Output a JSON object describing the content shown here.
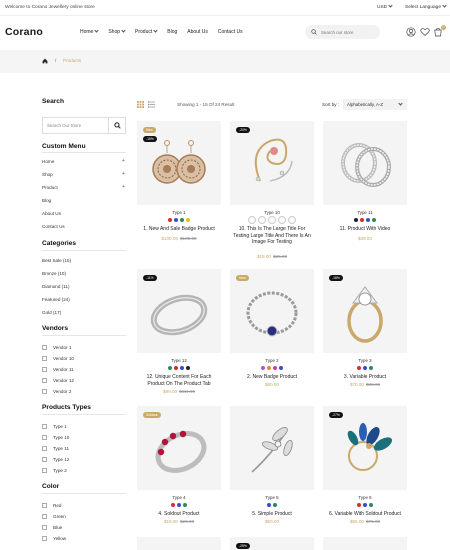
{
  "topbar": {
    "welcome": "Welcome to Corano Jewellery online store",
    "currency": "USD",
    "language": "Select Language"
  },
  "header": {
    "logo": "Corano",
    "nav": [
      "Home",
      "Shop",
      "Product",
      "Blog",
      "About Us",
      "Contact Us"
    ],
    "search_placeholder": "Search our store",
    "cart_count": "0"
  },
  "breadcrumb": {
    "separator": "/",
    "current": "Products"
  },
  "sidebar": {
    "search_title": "Search",
    "search_placeholder": "Search Our Store",
    "menu_title": "Custom Menu",
    "menu": [
      "Home",
      "Shop",
      "Product",
      "Blog",
      "About Us",
      "Contact Us"
    ],
    "categories_title": "Categories",
    "categories": [
      "Best Sale (15)",
      "Bronze (10)",
      "Diamond (11)",
      "Featured (24)",
      "Gold (17)"
    ],
    "vendors_title": "Vendors",
    "vendors": [
      "Vendor 1",
      "Vendor 10",
      "Vendor 11",
      "Vendor 12",
      "Vendor 2"
    ],
    "types_title": "Products Types",
    "types": [
      "Type 1",
      "Type 10",
      "Type 11",
      "Type 12",
      "Type 2"
    ],
    "color_title": "Color",
    "colors": [
      "Red",
      "Green",
      "Blue",
      "Yellow"
    ]
  },
  "toolbar": {
    "result": "Showing 1 - 15 Of 24 Result",
    "sort_label": "Sort by :",
    "sort_value": "Alphabetically, A-Z"
  },
  "products": [
    {
      "type": "Type 1",
      "name": "1. New And Sale Badge Product",
      "price": "$100.00",
      "old": "$136.00",
      "tag1": "New",
      "tag2": "-15%"
    },
    {
      "type": "Type 10",
      "name": "10. This Is The Large Title For Testing Large Title And There Is An Image For Testing",
      "price": "$19.00",
      "old": "$25.00",
      "tag1": "-20%",
      "tag2": ""
    },
    {
      "type": "Type 11",
      "name": "11. Product With Video",
      "price": "$39.00",
      "old": "",
      "tag1": "",
      "tag2": ""
    },
    {
      "type": "Type 12",
      "name": "12. Unique Content For Each Product On The Product Tab",
      "price": "$99.00",
      "old": "$111.00",
      "tag1": "-11%",
      "tag2": ""
    },
    {
      "type": "Type 2",
      "name": "2. New Badge Product",
      "price": "$80.00",
      "old": "",
      "tag1": "New",
      "tag2": ""
    },
    {
      "type": "Type 3",
      "name": "3. Variable Product",
      "price": "$70.00",
      "old": "$85.00",
      "tag1": "-18%",
      "tag2": ""
    },
    {
      "type": "Type 4",
      "name": "4. Soldout Product",
      "price": "$19.00",
      "old": "$20.00",
      "tag1": "Soldout",
      "tag2": ""
    },
    {
      "type": "Type 5",
      "name": "5. Simple Product",
      "price": "$50.00",
      "old": "",
      "tag1": "",
      "tag2": ""
    },
    {
      "type": "Type 6",
      "name": "6. Variable With Soldout Product",
      "price": "$55.00",
      "old": "$75.00",
      "tag1": "-27%",
      "tag2": ""
    }
  ],
  "bottom_tags": [
    "-25%"
  ],
  "colors": {
    "accent": "#c9a86a",
    "dark": "#111111",
    "panel": "#f4f4f4"
  }
}
